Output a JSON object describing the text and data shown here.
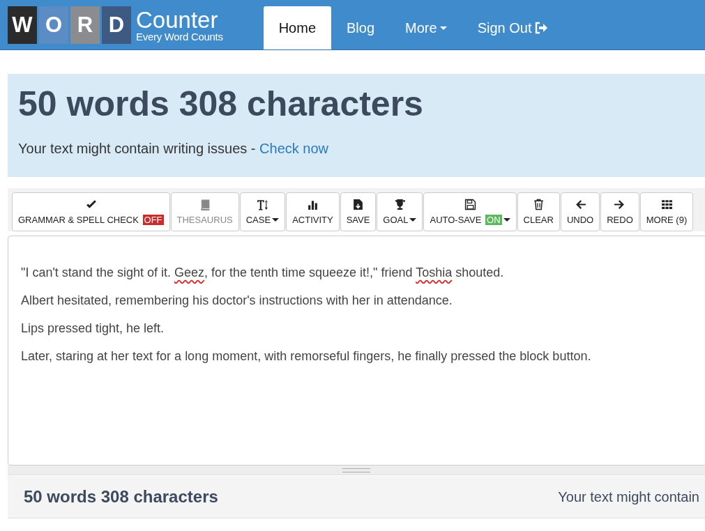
{
  "logo": {
    "letters": [
      "W",
      "O",
      "R",
      "D"
    ],
    "name": "Counter",
    "tagline": "Every Word Counts"
  },
  "nav": [
    {
      "label": "Home",
      "selected": true,
      "kind": "plain"
    },
    {
      "label": "Blog",
      "selected": false,
      "kind": "plain"
    },
    {
      "label": "More",
      "selected": false,
      "kind": "dropdown"
    },
    {
      "label": "Sign Out",
      "selected": false,
      "kind": "signout"
    }
  ],
  "summary": {
    "count": "50 words 308 characters",
    "notice": "Your text might contain writing issues - ",
    "link": "Check now"
  },
  "toolbar": [
    {
      "label": "GRAMMAR & SPELL CHECK",
      "badge": {
        "text": "OFF",
        "on": false
      },
      "dropdown": false,
      "disabled": false
    },
    {
      "label": "THESAURUS",
      "dropdown": false,
      "disabled": true
    },
    {
      "label": "CASE",
      "dropdown": true,
      "disabled": false
    },
    {
      "label": "ACTIVITY",
      "dropdown": false,
      "disabled": false
    },
    {
      "label": "SAVE",
      "dropdown": false,
      "disabled": false
    },
    {
      "label": "GOAL",
      "dropdown": true,
      "disabled": false
    },
    {
      "label": "AUTO-SAVE",
      "badge": {
        "text": "ON",
        "on": true
      },
      "dropdown": true,
      "disabled": false
    },
    {
      "label": "CLEAR",
      "dropdown": false,
      "disabled": false
    },
    {
      "label": "UNDO",
      "dropdown": false,
      "disabled": false
    },
    {
      "label": "REDO",
      "dropdown": false,
      "disabled": false
    },
    {
      "label": "MORE (9)",
      "dropdown": false,
      "disabled": false
    }
  ],
  "editor": {
    "paragraphs": [
      [
        {
          "text": "\"I can't stand the sight of it. ",
          "misspelled": false
        },
        {
          "text": "Geez",
          "misspelled": true
        },
        {
          "text": ", for the tenth time squeeze it!,\" friend ",
          "misspelled": false
        },
        {
          "text": "Toshia",
          "misspelled": true
        },
        {
          "text": " shouted.",
          "misspelled": false
        }
      ],
      [
        {
          "text": "Albert hesitated, remembering his doctor's instructions with her in attendance.",
          "misspelled": false
        }
      ],
      [
        {
          "text": "Lips pressed tight, he left.",
          "misspelled": false
        }
      ],
      [
        {
          "text": "Later, staring at her text for a long moment, with remorseful fingers, he finally pressed the block button.",
          "misspelled": false
        }
      ]
    ]
  },
  "footer": {
    "count": "50 words 308 characters",
    "notice": "Your text might contain"
  }
}
